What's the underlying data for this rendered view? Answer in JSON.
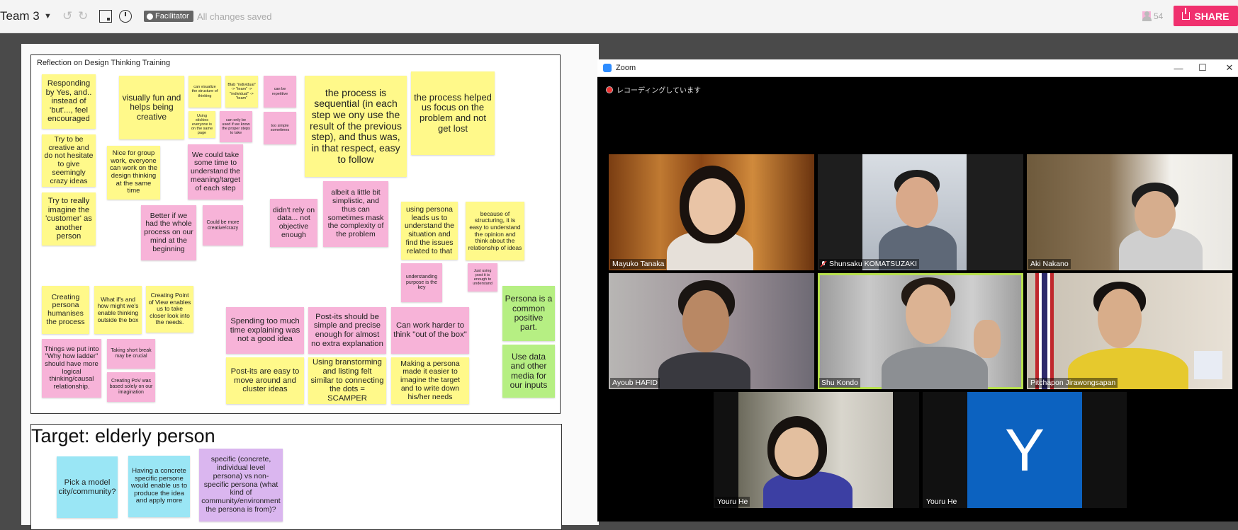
{
  "toolbar": {
    "board_name": "Team 3",
    "facilitator_label": "Facilitator",
    "status": "All changes saved",
    "user_count": "54",
    "share_label": "SHARE"
  },
  "board": {
    "frame1_title": "Reflection on Design Thinking Training",
    "frame2_title": "Target: elderly person",
    "notes": [
      "Responding by Yes, and.. instead of 'but'..., feel encouraged",
      "Try to be creative and do not hesitate to give seemingly crazy ideas",
      "Try to really imagine the 'customer' as another person",
      "visually fun and helps being creative",
      "can visualize the structure of thinking",
      "Using stickies everyone is on the same page",
      "Blab \"individual\" -> \"team\" -> \"individual\" -> \"team\"",
      "can only be used if we know the proper steps to take",
      "can be repetitive",
      "too simple sometimes",
      "Nice for group work, everyone can work on the design thinking at the same time",
      "We could take some time to understand the meaning/target of each step",
      "Better if we had the whole process on our mind at the beginning",
      "Could be more creative/crazy",
      "the process is sequential (in each step we ony use the result of the previous step), and thus was, in that respect, easy to follow",
      "the process helped us focus on the problem and not get lost",
      "didn't rely on data... not objective enough",
      "albeit a little bit simplistic, and thus can sometimes mask the complexity of the problem",
      "using persona leads us to understand the situation and find the issues related to that",
      "because of structuring, it is easy to understand the opinion and think about the relationship of ideas",
      "understanding purpose is the key",
      "Just using post it is enough to understand",
      "Creating persona humanises the process",
      "What if's and how might we's enable thinking outside the box",
      "Creating Point of View enables us to take closer look into the needs.",
      "Things we put into \"Why how ladder\" should have more logical thinking/causal relationship.",
      "Taking short break may be crucial",
      "Creating PoV was based solely on our imagination",
      "Spending too much time explaining was not a good idea",
      "Post-its should be simple and precise enough for almost no extra explanation",
      "Can work harder to think \"out of the box\"",
      "Persona is a common positive part.",
      "Post-its are easy to move around and cluster ideas",
      "Using branstorming and listing felt similar to connecting the dots = SCAMPER",
      "Making a persona made it easier to imagine the target and to write down his/her needs",
      "Use data and other media for our inputs",
      "Pick a model city/community?",
      "Having a concrete specific persone would enable us to produce the idea and apply more",
      "specific (concrete, individual level persona) vs non-specific persona (what kind of community/environment the persona is from)?"
    ]
  },
  "zoom": {
    "title": "Zoom",
    "recording": "レコーディングしています",
    "participants": [
      "Mayuko Tanaka",
      "Shunsaku KOMATSUZAKI",
      "Aki Nakano",
      "Ayoub HAFID",
      "Shu Kondo",
      "Pitchapon Jirawongsapan",
      "Youru He",
      "Youru He"
    ],
    "avatar_letter": "Y"
  }
}
